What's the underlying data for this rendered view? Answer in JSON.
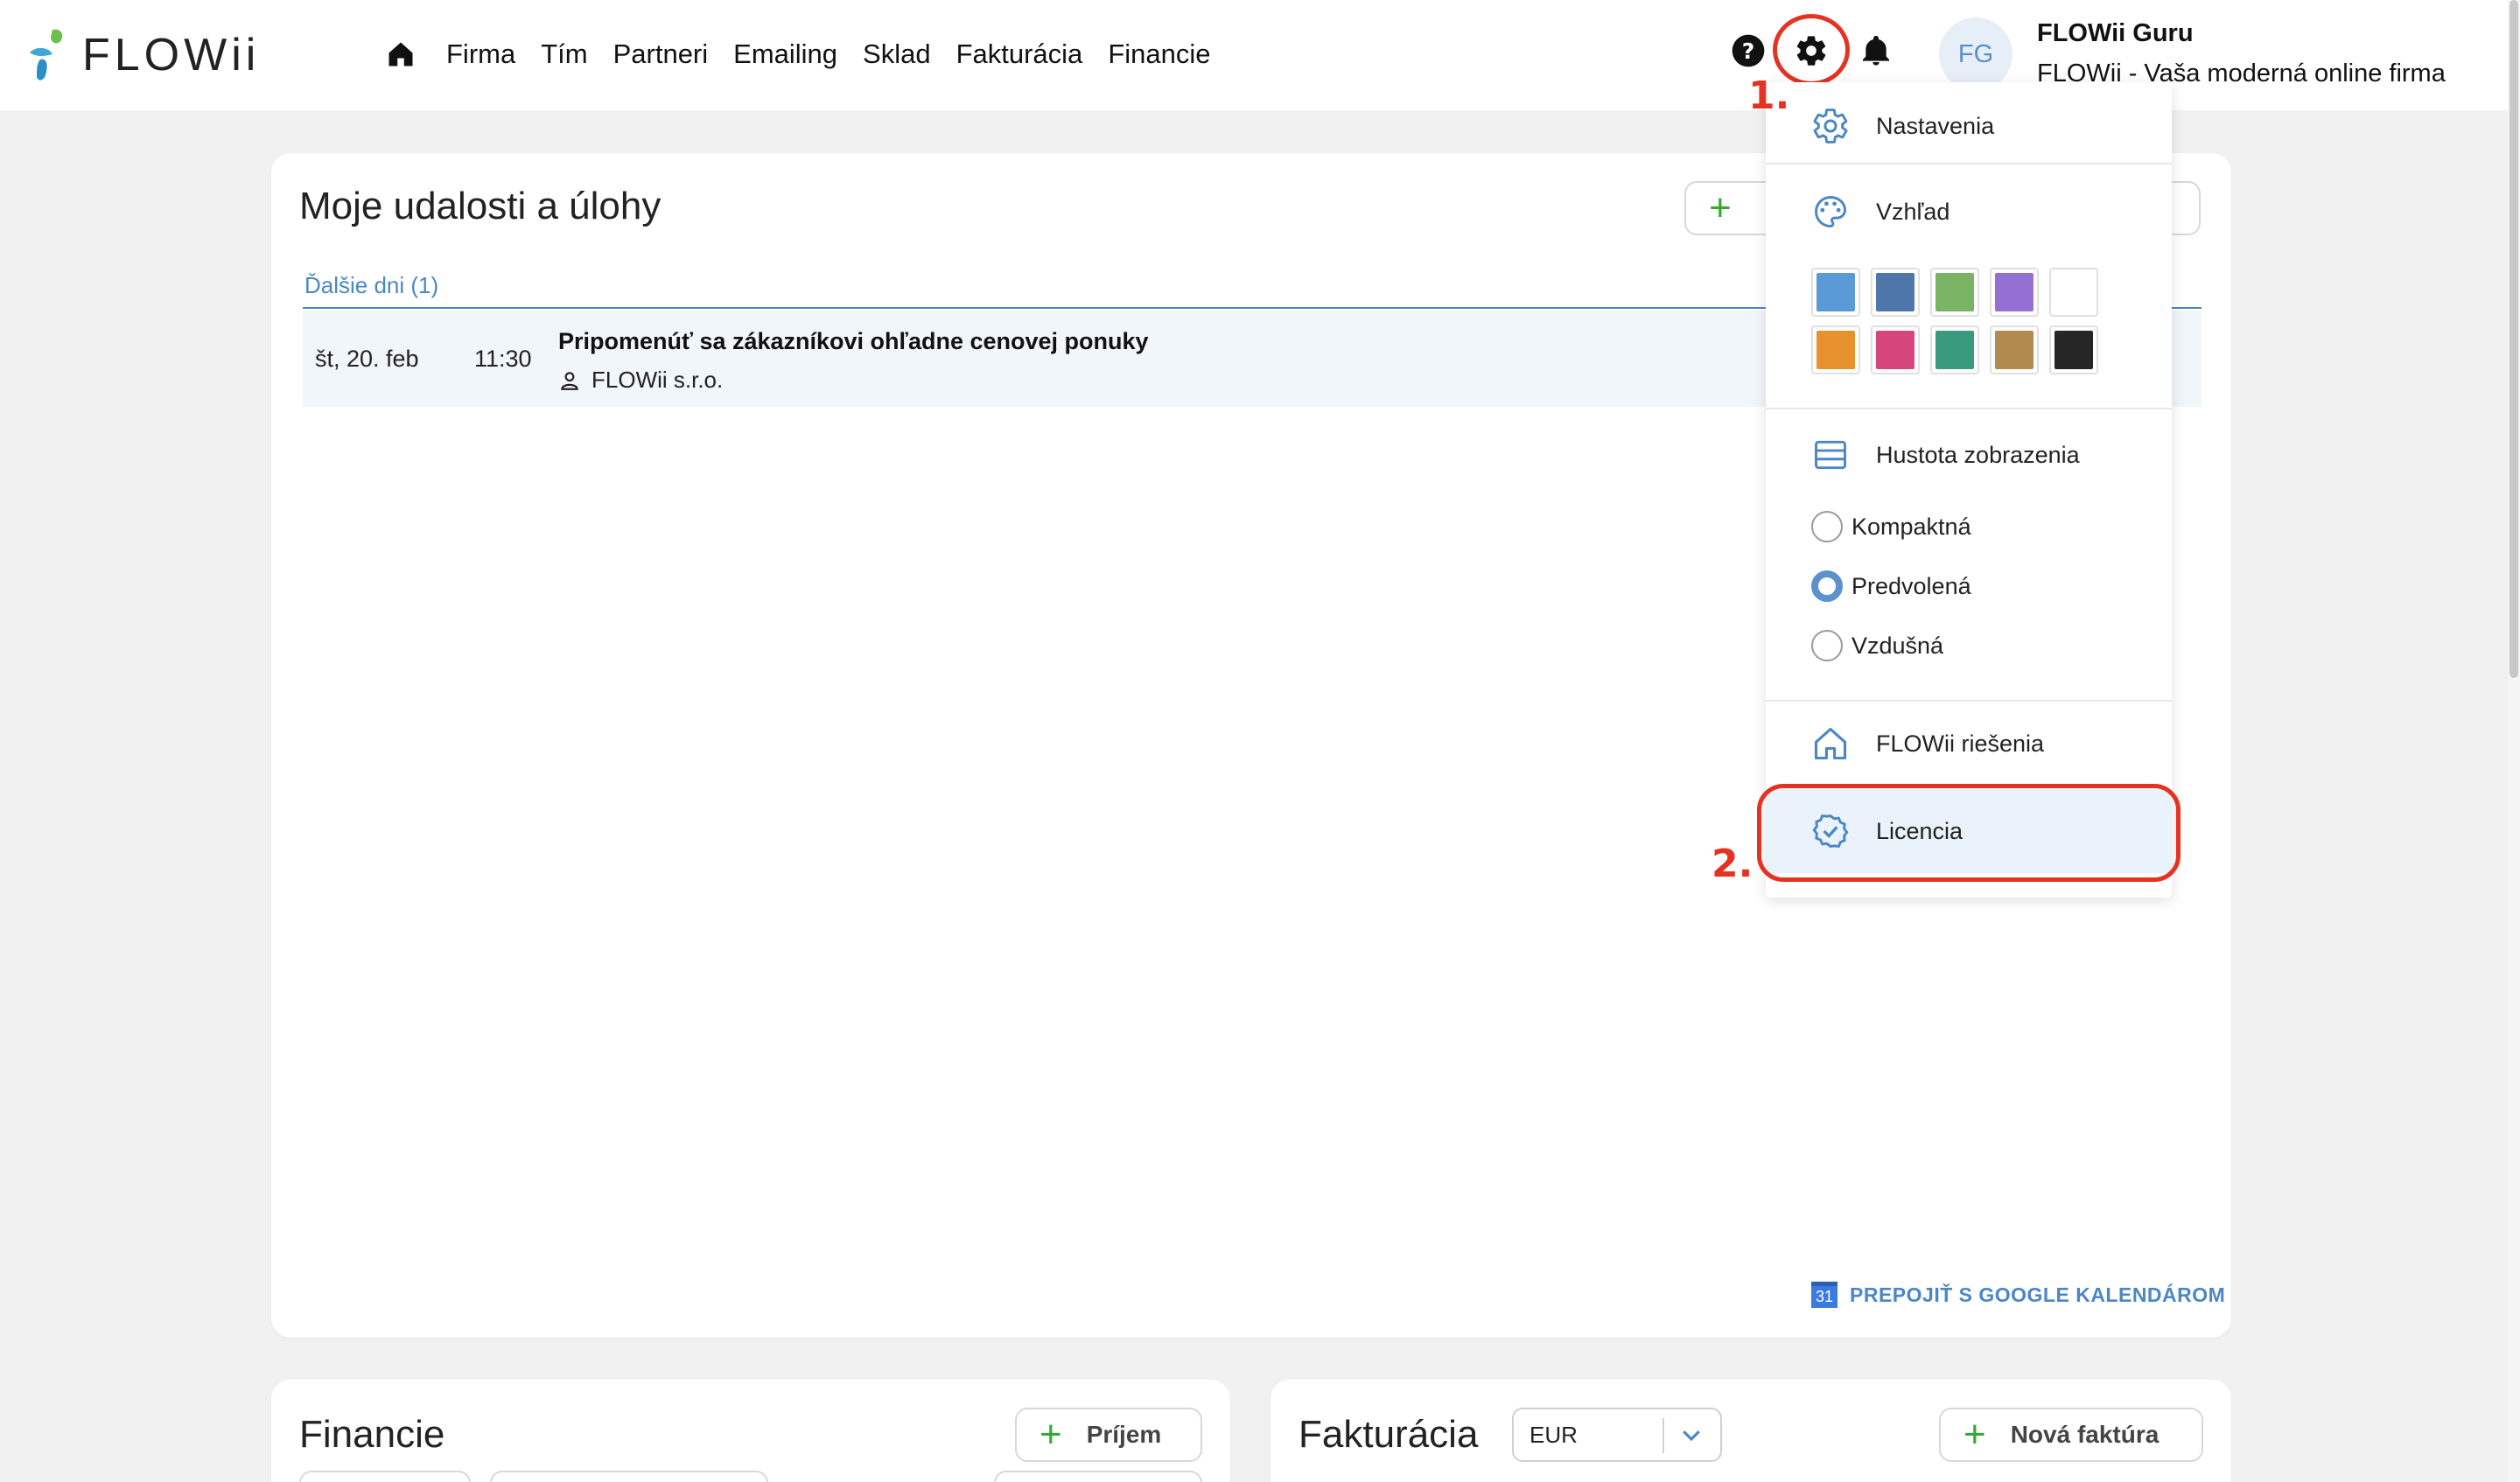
{
  "header": {
    "logo_text": "FLOWii",
    "nav": [
      "Firma",
      "Tím",
      "Partneri",
      "Emailing",
      "Sklad",
      "Fakturácia",
      "Financie"
    ],
    "user": {
      "initials": "FG",
      "name": "FLOWii Guru",
      "company": "FLOWii - Vaša moderná online firma"
    },
    "icons": [
      "home-icon",
      "help-icon",
      "gear-icon",
      "bell-icon"
    ]
  },
  "annotations": {
    "step1": "1.",
    "step2": "2.",
    "color": "#e53221"
  },
  "events": {
    "title": "Moje udalosti a úlohy",
    "section": "Ďalšie dni (1)",
    "items": [
      {
        "date": "št, 20. feb",
        "time": "11:30",
        "title": "Pripomenúť sa zákazníkovi ohľadne cenovej ponuky",
        "company": "FLOWii s.r.o."
      }
    ],
    "google_link": "PREPOJIŤ S GOOGLE KALENDÁROM",
    "gcal_icon_text": "31"
  },
  "finance": {
    "title": "Financie",
    "income_button": "Príjem"
  },
  "invoicing": {
    "title": "Fakturácia",
    "currency": "EUR",
    "new_invoice_button": "Nová faktúra"
  },
  "settings_menu": {
    "nastavenia": "Nastavenia",
    "vzhlad": "Vzhľad",
    "colors": [
      "#5a9bd7",
      "#4e76ab",
      "#78b464",
      "#9470d4",
      "#ffffff",
      "#e8922e",
      "#d6457c",
      "#3a9a7e",
      "#b08a4e",
      "#262626"
    ],
    "density_label": "Hustota zobrazenia",
    "density_options": [
      "Kompaktná",
      "Predvolená",
      "Vzdušná"
    ],
    "density_selected": "Predvolená",
    "solutions": "FLOWii riešenia",
    "license": "Licencia"
  },
  "accent": "#4b86c6"
}
